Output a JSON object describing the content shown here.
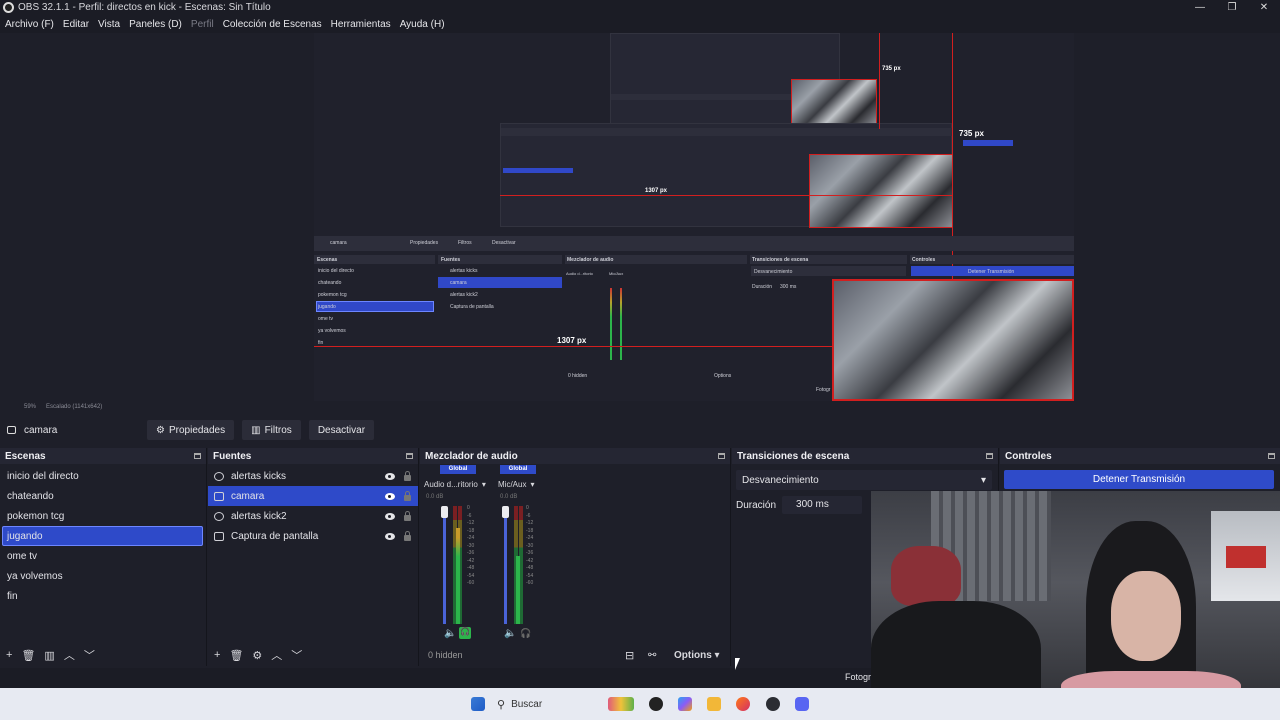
{
  "window": {
    "title": "OBS 32.1.1 - Perfil: directos en kick - Escenas: Sin Título"
  },
  "menu": [
    "Archivo (F)",
    "Editar",
    "Vista",
    "Paneles (D)",
    "Perfil",
    "Colección de Escenas",
    "Herramientas",
    "Ayuda (H)"
  ],
  "preview": {
    "measure_h": "735 px",
    "measure_w": "1307 px",
    "measure_h_small": "735 px",
    "measure_w_small": "1307 px",
    "zoom": "59%",
    "scale": "Escalado (1141x642)",
    "nested_controls": "Controles",
    "nested_stop": "Detener Transmisión",
    "nested_trans": "Transiciones de escena",
    "nested_fade": "Desvanecimiento",
    "nested_dur": "Duración",
    "nested_ms": "300 ms",
    "nested_scenes_title": "Escenas",
    "nested_sources_title": "Fuentes",
    "nested_mixer_title": "Mezclador de audio",
    "nested_source": "camara",
    "nested_props": "Propiedades",
    "nested_filters": "Filtros",
    "nested_deact": "Desactivar",
    "nested_scenes": [
      "inicio del directo",
      "chateando",
      "pokemon tcg",
      "jugando",
      "ome tv",
      "ya volvemos",
      "fin"
    ],
    "nested_sources": [
      "alertas kicks",
      "camara",
      "alertas kick2",
      "Captura de pantalla"
    ],
    "nested_global": "Global",
    "nested_ch1": "Audio d...ritorio",
    "nested_ch2": "Mic/Aux",
    "nested_hidden": "0 hidden",
    "nested_options": "Options",
    "nested_foto": "Fotogr"
  },
  "context": {
    "source_name": "camara",
    "properties": "Propiedades",
    "filters": "Filtros",
    "deactivate": "Desactivar"
  },
  "scenes": {
    "title": "Escenas",
    "items": [
      "inicio del directo",
      "chateando",
      "pokemon tcg",
      "jugando",
      "ome tv",
      "ya volvemos",
      "fin"
    ],
    "selected": "jugando"
  },
  "sources": {
    "title": "Fuentes",
    "items": [
      {
        "label": "alertas kicks",
        "icon": "globe-icon"
      },
      {
        "label": "camara",
        "icon": "camera-icon"
      },
      {
        "label": "alertas kick2",
        "icon": "globe-icon"
      },
      {
        "label": "Captura de pantalla",
        "icon": "monitor-icon"
      }
    ],
    "selected": "camara"
  },
  "mixer": {
    "title": "Mezclador de audio",
    "channels": [
      {
        "badge": "Global",
        "name": "Audio d...ritorio",
        "db": "0.0 dB"
      },
      {
        "badge": "Global",
        "name": "Mic/Aux",
        "db": "0.0 dB"
      }
    ],
    "ticks": [
      "0",
      "-6",
      "-12",
      "-18",
      "-24",
      "-30",
      "-36",
      "-42",
      "-48",
      "-54",
      "-60"
    ],
    "hidden": "0 hidden",
    "options": "Options"
  },
  "transitions": {
    "title": "Transiciones de escena",
    "current": "Desvanecimiento",
    "duration_label": "Duración",
    "duration_value": "300 ms"
  },
  "controls": {
    "title": "Controles",
    "stop_stream": "Detener Transmisión"
  },
  "statusbar": {
    "fps_label": "Fotogr"
  },
  "taskbar": {
    "search": "Buscar"
  },
  "colors": {
    "accent": "#2f4bc9",
    "measure": "#d21f1f",
    "bg": "#1e1f29"
  }
}
